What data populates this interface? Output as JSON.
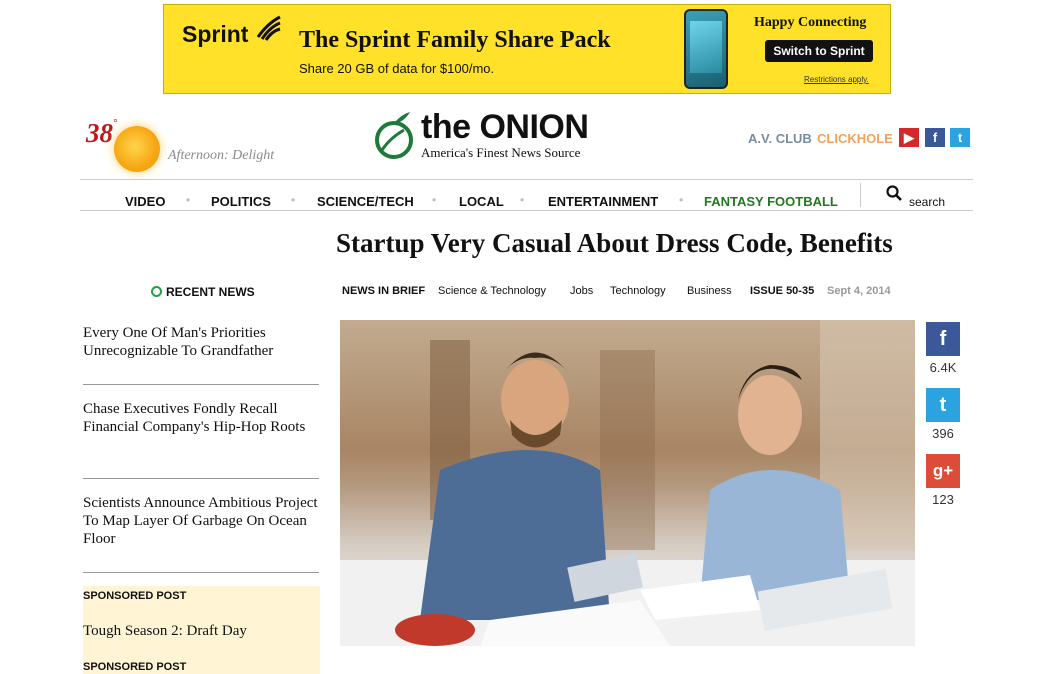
{
  "ad": {
    "brand": "Sprint",
    "headline": "The Sprint Family Share Pack",
    "subline": "Share 20 GB of data for $100/mo.",
    "happy": "Happy Connecting",
    "cta": "Switch to Sprint",
    "restrictions": "Restrictions apply."
  },
  "weather": {
    "temp": "38",
    "unit": "°",
    "desc": "Afternoon: Delight"
  },
  "logo": {
    "name": "the ONION",
    "tagline": "America's Finest News Source"
  },
  "partners": {
    "avclub": "A.V. CLUB",
    "clickhole": "CLICKHOLE"
  },
  "nav": {
    "items": [
      "VIDEO",
      "POLITICS",
      "SCIENCE/TECH",
      "LOCAL",
      "ENTERTAINMENT",
      "FANTASY FOOTBALL"
    ],
    "search": "search"
  },
  "article": {
    "title": "Startup Very Casual About Dress Code, Benefits",
    "meta": {
      "section": "NEWS IN BRIEF",
      "tags": [
        "Science & Technology",
        "Jobs",
        "Technology",
        "Business"
      ],
      "issue": "ISSUE 50-35",
      "date": "Sept 4, 2014"
    }
  },
  "sidebar": {
    "heading": "RECENT NEWS",
    "stories": [
      "Every One Of Man's Priorities Unrecognizable To Grandfather",
      "Chase Executives Fondly Recall Financial Company's Hip-Hop Roots",
      "Scientists Announce Ambitious Project To Map Layer Of Garbage On Ocean Floor"
    ],
    "sponsored_label": "SPONSORED POST",
    "sponsored_title": "Tough Season 2: Draft Day"
  },
  "social": {
    "facebook": "6.4K",
    "twitter": "396",
    "gplus": "123"
  },
  "colors": {
    "ad_yellow": "#ffe12a",
    "onion_green": "#1f7a3a",
    "nav_green": "#1f7a1f",
    "temp_red": "#c0131a"
  }
}
